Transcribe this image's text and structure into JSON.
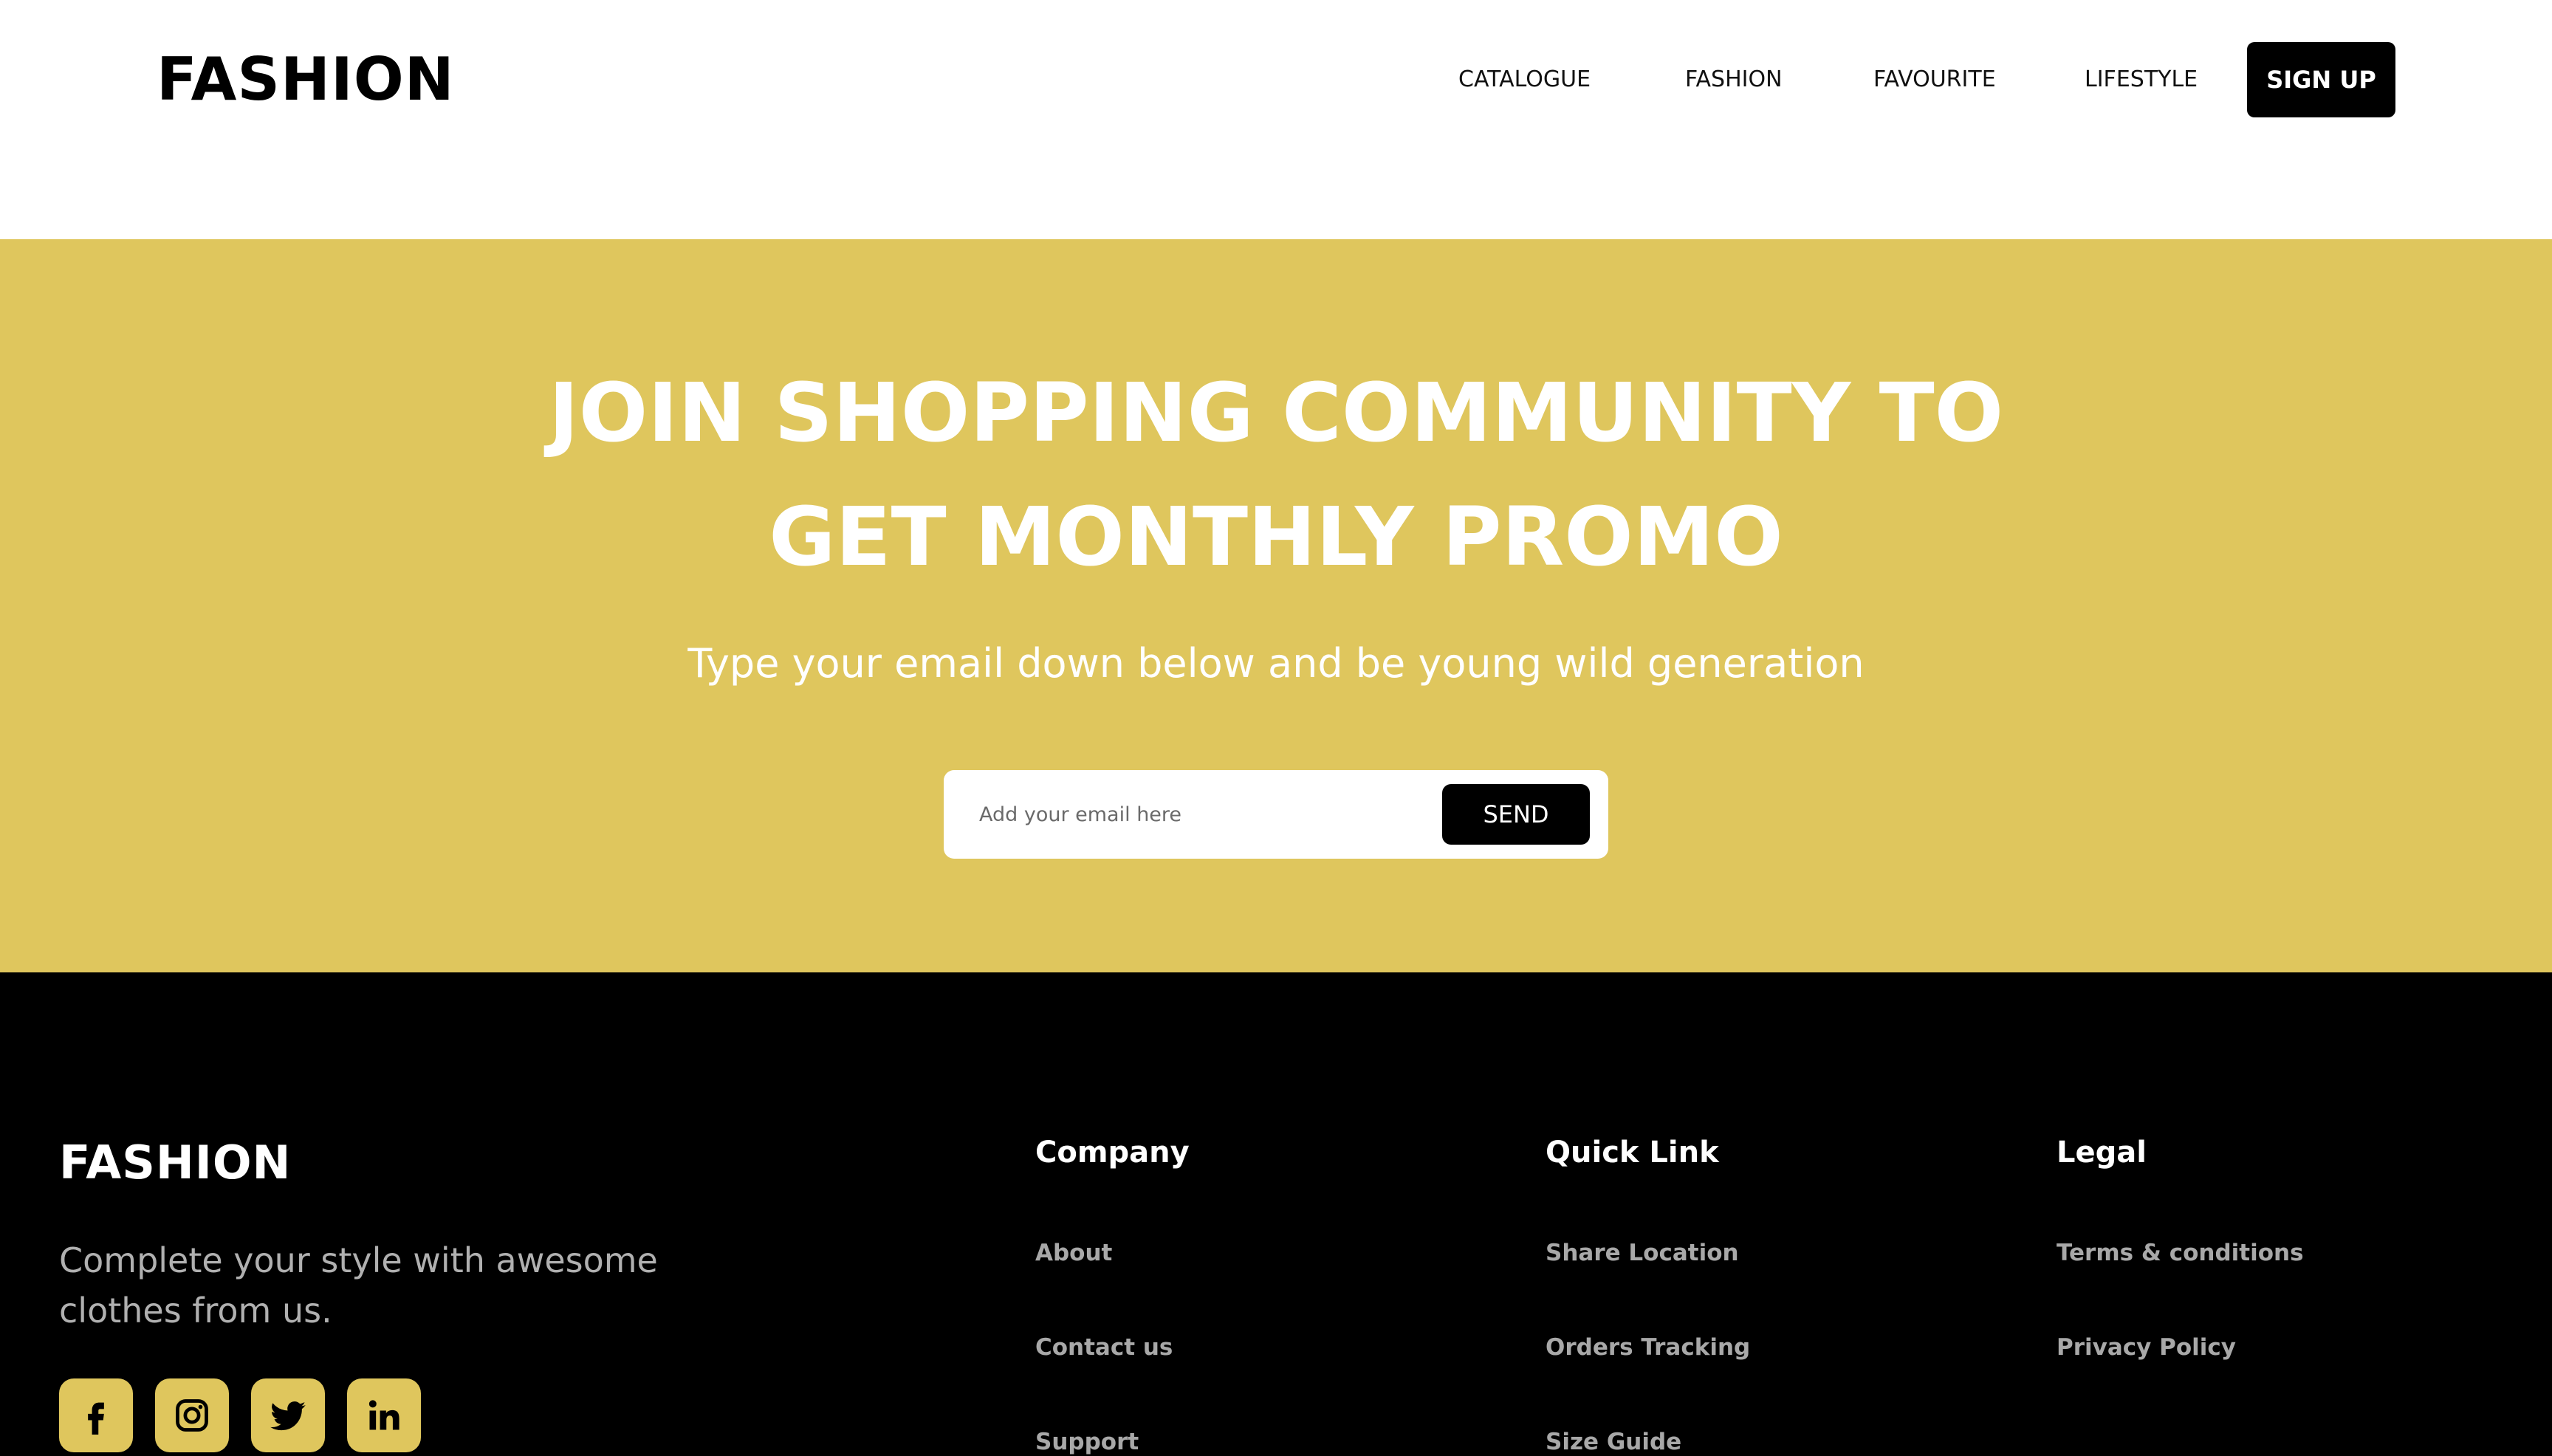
{
  "header": {
    "logo": "FASHION",
    "nav": {
      "catalogue": "CATALOGUE",
      "fashion": "FASHION",
      "favourite": "FAVOURITE",
      "lifestyle": "LIFESTYLE"
    },
    "signup_label": "SIGN UP"
  },
  "promo": {
    "title_line1": "JOIN SHOPPING COMMUNITY TO",
    "title_line2": "GET MONTHLY PROMO",
    "subtitle": "Type your email down below and be young wild generation",
    "email_placeholder": "Add your email here",
    "email_value": "",
    "send_label": "SEND",
    "background_color": "#dfc65d"
  },
  "footer": {
    "logo": "FASHION",
    "tagline": "Complete your style with awesome clothes from us.",
    "social": [
      {
        "icon": "facebook-icon"
      },
      {
        "icon": "instagram-icon"
      },
      {
        "icon": "twitter-icon"
      },
      {
        "icon": "linkedin-icon"
      }
    ],
    "columns": [
      {
        "title": "Company",
        "links": [
          "About",
          "Contact us",
          "Support"
        ]
      },
      {
        "title": "Quick Link",
        "links": [
          "Share Location",
          "Orders Tracking",
          "Size Guide"
        ]
      },
      {
        "title": "Legal",
        "links": [
          "Terms & conditions",
          "Privacy Policy"
        ]
      }
    ]
  },
  "colors": {
    "accent": "#dfc65d",
    "dark": "#000000",
    "light": "#ffffff",
    "muted_text": "#a8a8a8"
  }
}
